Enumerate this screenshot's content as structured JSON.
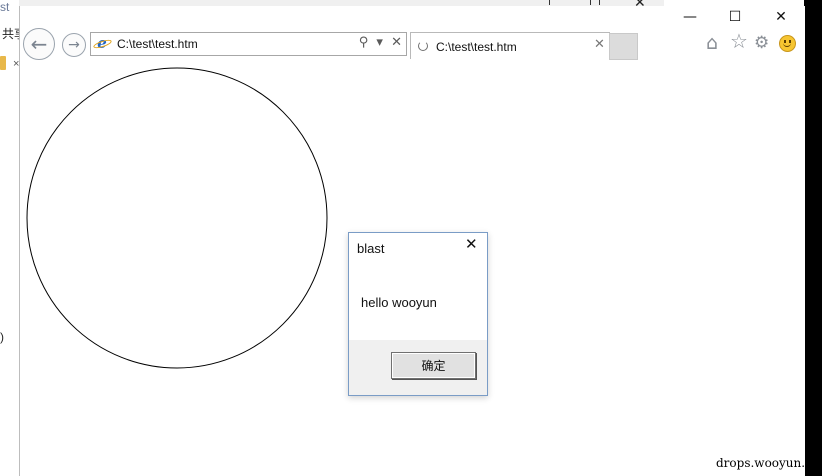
{
  "background_window": {
    "title_fragment": "st",
    "menu_fragment": "共享",
    "row_mark": "×",
    "count_fragment": ")",
    "close_glyph": "✕"
  },
  "browser": {
    "window_controls": {
      "minimize": "—",
      "maximize": "☐",
      "close": "✕"
    },
    "nav": {
      "back_glyph": "←",
      "forward_glyph": "→"
    },
    "address_bar": {
      "url": "C:\\test\\test.htm",
      "search_glyph": "⚲",
      "dropdown_glyph": "▾",
      "stop_glyph": "✕"
    },
    "tabs": [
      {
        "label": "C:\\test\\test.htm",
        "close_glyph": "✕"
      }
    ],
    "toolbar_icons": {
      "home": "⌂",
      "favorites": "☆",
      "settings": "⚙"
    }
  },
  "page": {
    "shape": "circle"
  },
  "dialog": {
    "title": "blast",
    "close_glyph": "✕",
    "message": "hello wooyun",
    "ok_label": "确定"
  },
  "watermark": "drops.wooyun.c",
  "colors": {
    "dialog_border": "#7a9cc6",
    "footer_bg": "#f0f0f0",
    "ie_blue": "#1d63c7"
  }
}
